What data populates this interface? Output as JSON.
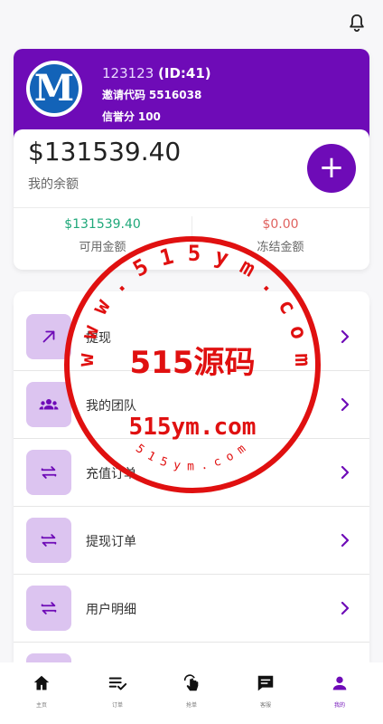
{
  "header": {
    "bell_icon": "bell-icon"
  },
  "profile": {
    "username": "123123",
    "id_text": "(ID:41)",
    "invite_label": "邀请代码",
    "invite_code": "5516038",
    "credit_label": "信誉分",
    "credit_value": "100",
    "avatar_letter": "M"
  },
  "balance": {
    "amount": "$131539.40",
    "label": "我的余额",
    "available_value": "$131539.40",
    "available_label": "可用金额",
    "frozen_value": "$0.00",
    "frozen_label": "冻结金额"
  },
  "menu": [
    {
      "label": "提现",
      "icon": "arrow-up-right-icon"
    },
    {
      "label": "我的团队",
      "icon": "group-icon"
    },
    {
      "label": "充值订单",
      "icon": "swap-icon"
    },
    {
      "label": "提现订单",
      "icon": "swap-icon"
    },
    {
      "label": "用户明细",
      "icon": "swap-icon"
    }
  ],
  "tabs": [
    {
      "label": "主页",
      "icon": "home-icon"
    },
    {
      "label": "订单",
      "icon": "checklist-icon"
    },
    {
      "label": "抢单",
      "icon": "tap-icon"
    },
    {
      "label": "客服",
      "icon": "chat-icon"
    },
    {
      "label": "我的",
      "icon": "person-icon"
    }
  ],
  "watermark": {
    "top_arc": "w w w . 5 1 5 y m . c o m",
    "center_cn": "515源码",
    "center_en": "515ym.com",
    "bottom_arc": "5 1 5 y m . c o m"
  },
  "colors": {
    "accent": "#6e0bb7",
    "available": "#1fa87a",
    "frozen": "#e0625f",
    "icon_bg": "#dcc4f0",
    "watermark": "#e01010"
  }
}
